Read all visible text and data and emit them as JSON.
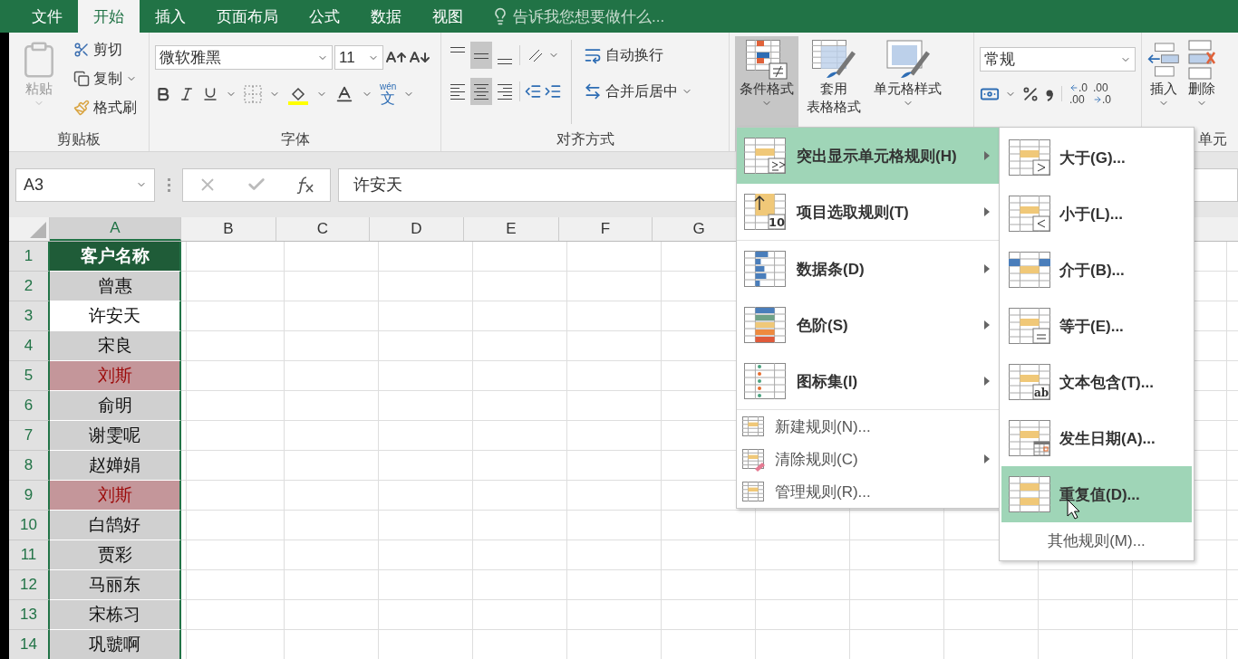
{
  "tabs": [
    {
      "label": "文件",
      "selected": false
    },
    {
      "label": "开始",
      "selected": true
    },
    {
      "label": "插入",
      "selected": false
    },
    {
      "label": "页面布局",
      "selected": false
    },
    {
      "label": "公式",
      "selected": false
    },
    {
      "label": "数据",
      "selected": false
    },
    {
      "label": "视图",
      "selected": false
    }
  ],
  "tell_me": {
    "placeholder": "告诉我您想要做什么..."
  },
  "ribbon": {
    "clipboard": {
      "paste": "粘贴",
      "cut": "剪切",
      "copy": "复制",
      "format_painter": "格式刷",
      "label": "剪贴板"
    },
    "font": {
      "name": "微软雅黑",
      "size": "11",
      "phonetic_top": "wén",
      "phonetic_bottom": "文",
      "label": "字体"
    },
    "alignment": {
      "vertical": [
        {
          "kind": "top",
          "selected": false
        },
        {
          "kind": "middle",
          "selected": true
        },
        {
          "kind": "bottom",
          "selected": false
        }
      ],
      "horizontal": [
        {
          "kind": "left",
          "selected": false
        },
        {
          "kind": "center",
          "selected": true
        },
        {
          "kind": "right",
          "selected": false
        }
      ],
      "wrap_text": "自动换行",
      "merge": "合并后居中",
      "label": "对齐方式"
    },
    "styles": {
      "conditional_formatting": {
        "label": "条件格式",
        "selected": true
      },
      "format_as_table": [
        "套用",
        "表格格式"
      ],
      "cell_styles": "单元格样式"
    },
    "number": {
      "format": "常规",
      "decimals": [
        {
          "kind": "increase",
          "top": ".0",
          "bottom": ".00"
        },
        {
          "kind": "decrease",
          "top": ".00",
          "bottom": ".0"
        }
      ]
    },
    "cells": {
      "insert": "插入",
      "delete": "删除",
      "label": "单元"
    }
  },
  "formula_bar": {
    "name_box": "A3",
    "value": "许安天"
  },
  "columns": [
    {
      "label": "A",
      "selected": true
    },
    {
      "label": "B",
      "selected": false
    },
    {
      "label": "C",
      "selected": false
    },
    {
      "label": "D",
      "selected": false
    },
    {
      "label": "E",
      "selected": false
    },
    {
      "label": "F",
      "selected": false
    },
    {
      "label": "G",
      "selected": false
    }
  ],
  "rows": [
    {
      "number": "1",
      "value": "客户名称",
      "kind": "header",
      "selected": false
    },
    {
      "number": "2",
      "value": "曾惠",
      "kind": "normal",
      "selected": false
    },
    {
      "number": "3",
      "value": "许安天",
      "kind": "normal",
      "selected": true
    },
    {
      "number": "4",
      "value": "宋良",
      "kind": "normal",
      "selected": false
    },
    {
      "number": "5",
      "value": "刘斯",
      "kind": "duplicate",
      "selected": false
    },
    {
      "number": "6",
      "value": "俞明",
      "kind": "normal",
      "selected": false
    },
    {
      "number": "7",
      "value": "谢雯呢",
      "kind": "normal",
      "selected": false
    },
    {
      "number": "8",
      "value": "赵婵娟",
      "kind": "normal",
      "selected": false
    },
    {
      "number": "9",
      "value": "刘斯",
      "kind": "duplicate",
      "selected": false
    },
    {
      "number": "10",
      "value": "白鹄好",
      "kind": "normal",
      "selected": false
    },
    {
      "number": "11",
      "value": "贾彩",
      "kind": "normal",
      "selected": false
    },
    {
      "number": "12",
      "value": "马丽东",
      "kind": "normal",
      "selected": false
    },
    {
      "number": "13",
      "value": "宋栋习",
      "kind": "normal",
      "selected": false
    },
    {
      "number": "14",
      "value": "巩虢啊",
      "kind": "normal",
      "selected": false
    }
  ],
  "menu": {
    "groups": [
      [
        {
          "kind": "highlight",
          "label": "突出显示单元格规则(H)",
          "submenu": true,
          "selected": true
        },
        {
          "kind": "top10",
          "label": "项目选取规则(T)",
          "badge": "10",
          "submenu": true,
          "selected": false
        }
      ],
      [
        {
          "kind": "databar",
          "label": "数据条(D)",
          "submenu": true,
          "selected": false
        },
        {
          "kind": "colorscale",
          "label": "色阶(S)",
          "submenu": true,
          "selected": false
        },
        {
          "kind": "iconset",
          "label": "图标集(I)",
          "submenu": true,
          "selected": false
        }
      ],
      [
        {
          "kind": "new",
          "label": "新建规则(N)...",
          "submenu": false,
          "selected": false
        },
        {
          "kind": "clear",
          "label": "清除规则(C)",
          "submenu": true,
          "selected": false
        },
        {
          "kind": "manage",
          "label": "管理规则(R)...",
          "submenu": false,
          "selected": false
        }
      ]
    ]
  },
  "submenu": {
    "items": [
      {
        "kind": "gt",
        "label": "大于(G)...",
        "selected": false
      },
      {
        "kind": "lt",
        "label": "小于(L)...",
        "selected": false
      },
      {
        "kind": "between",
        "label": "介于(B)...",
        "selected": false
      },
      {
        "kind": "eq",
        "label": "等于(E)...",
        "selected": false
      },
      {
        "kind": "text",
        "label": "文本包含(T)...",
        "badge": "ab",
        "selected": false
      },
      {
        "kind": "date",
        "label": "发生日期(A)...",
        "selected": false
      },
      {
        "kind": "dup",
        "label": "重复值(D)...",
        "selected": true
      }
    ],
    "more": "其他规则(M)..."
  }
}
